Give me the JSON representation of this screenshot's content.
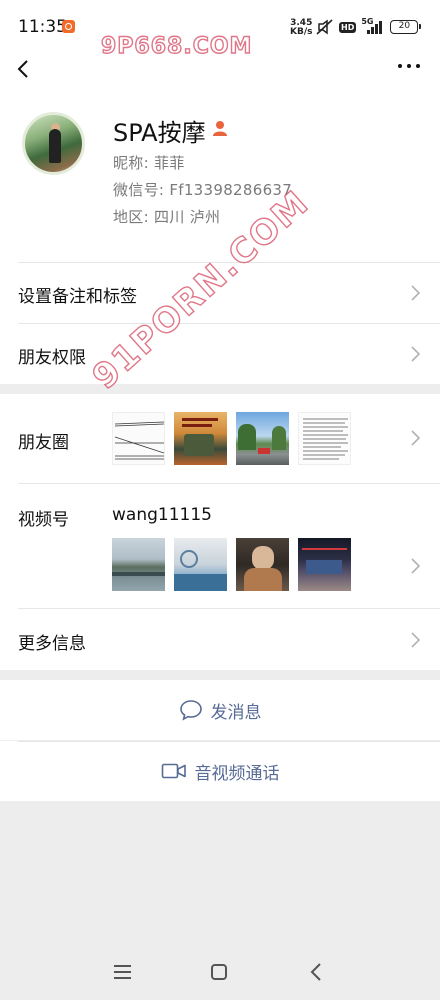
{
  "status_bar": {
    "time": "11:35",
    "net_speed_value": "3.45",
    "net_speed_unit": "KB/s",
    "hd_badge": "HD",
    "network_type": "5G",
    "battery": "20"
  },
  "watermarks": {
    "top": "9P668.COM",
    "diagonal": "91PORN.COM"
  },
  "profile": {
    "display_name": "SPA按摩",
    "nickname_line": "昵称:  菲菲",
    "wechat_id_line": "微信号:  Ff13398286637",
    "region_line": "地区:  四川  泸州"
  },
  "rows": {
    "remark_tags": "设置备注和标签",
    "friend_permissions": "朋友权限",
    "moments": "朋友圈",
    "channels": "视频号",
    "channels_id": "wang11115",
    "more_info": "更多信息"
  },
  "actions": {
    "send_message": "发消息",
    "video_call": "音视频通话"
  },
  "colors": {
    "link_blue": "#576b95",
    "tag_orange": "#e8643c",
    "background": "#ededed"
  }
}
